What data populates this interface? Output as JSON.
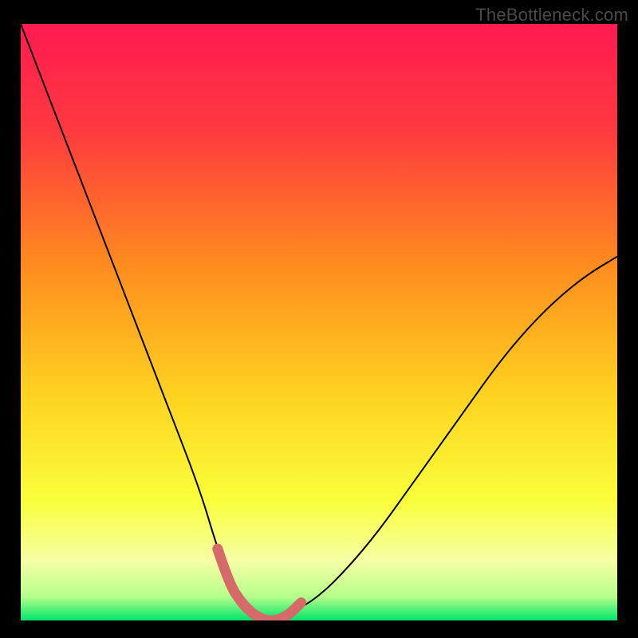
{
  "watermark": "TheBottleneck.com",
  "chart_data": {
    "type": "line",
    "title": "",
    "xlabel": "",
    "ylabel": "",
    "xlim": [
      0,
      100
    ],
    "ylim": [
      0,
      100
    ],
    "annotations": [],
    "series": [
      {
        "name": "bottleneck-curve",
        "x": [
          0,
          5,
          10,
          15,
          20,
          25,
          30,
          33,
          35,
          37,
          39,
          41,
          43,
          45,
          50,
          55,
          60,
          65,
          70,
          75,
          80,
          85,
          90,
          95,
          100
        ],
        "values": [
          100,
          87,
          74,
          61,
          48,
          35,
          22,
          12,
          7,
          3,
          1,
          0,
          0,
          1,
          4,
          9,
          15,
          22,
          29,
          36,
          43,
          49,
          54,
          58,
          61
        ]
      }
    ],
    "highlight_band": {
      "name": "optimal-range",
      "x": [
        33,
        35,
        37,
        39,
        41,
        43,
        45,
        47
      ],
      "values": [
        12,
        6,
        3,
        1,
        0,
        0,
        1,
        3
      ]
    },
    "gradient_stops": [
      {
        "offset": 0.0,
        "color": "#ff1a4f"
      },
      {
        "offset": 0.18,
        "color": "#ff3a3f"
      },
      {
        "offset": 0.4,
        "color": "#ff8a1f"
      },
      {
        "offset": 0.62,
        "color": "#ffd21f"
      },
      {
        "offset": 0.8,
        "color": "#f9ff3a"
      },
      {
        "offset": 0.9,
        "color": "#f6ffa5"
      },
      {
        "offset": 0.96,
        "color": "#b6ff8a"
      },
      {
        "offset": 1.0,
        "color": "#00e56a"
      }
    ]
  }
}
